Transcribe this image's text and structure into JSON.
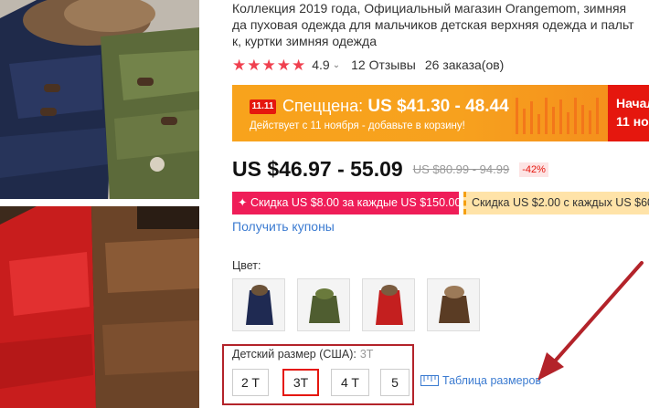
{
  "product": {
    "title_lines": [
      "Коллекция 2019 года, Официальный магазин Orangemom, зимняя",
      "да пуховая одежда для мальчиков детская верхняя одежда и пальт",
      "к, куртки зимняя одежда"
    ],
    "rating": "4.9",
    "reviews": "12 Отзывы",
    "orders": "26 заказа(ов)"
  },
  "promo": {
    "badge": "11.11",
    "label": "Спеццена:",
    "price": "US $41.30 - 48.44",
    "subtitle": "Действует с 11 ноября - добавьте в корзину!",
    "side_line1": "Начал",
    "side_line2": "11 но"
  },
  "price": {
    "current": "US $46.97 - 55.09",
    "old": "US $80.99 - 94.99",
    "discount": "-42%"
  },
  "coupons": {
    "coupon1": "✦ Скидка US $8.00 за каждые US $150.00",
    "coupon2": "Скидка US $2.00 с каждых US $60",
    "get_link": "Получить купоны"
  },
  "color": {
    "label": "Цвет:",
    "swatch_count": 4
  },
  "size": {
    "label": "Детский размер (США):",
    "selected": "3T",
    "options": [
      "2 T",
      "3T",
      "4 T",
      "5"
    ],
    "chart_link": "Таблица размеров"
  },
  "colors": {
    "accent_red": "#e5170e",
    "link_blue": "#3b7bd1",
    "star_red": "#f0404f",
    "banner_orange": "#f8a31c",
    "coupon_pink": "#ef1d58",
    "highlight_box": "#b3232a"
  }
}
